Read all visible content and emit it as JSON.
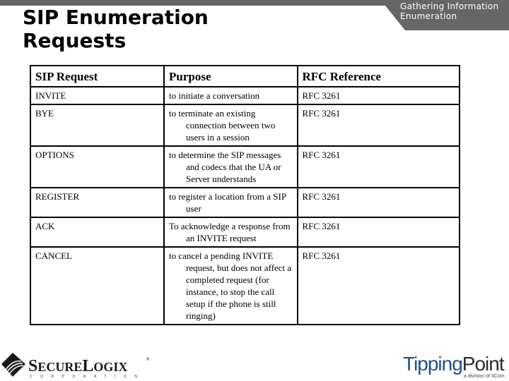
{
  "header": {
    "section_label_line1": "Gathering Information",
    "section_label_line2": "Enumeration",
    "bar_color": "#666666",
    "title_line1": "SIP Enumeration",
    "title_line2": "Requests"
  },
  "table": {
    "columns": [
      "SIP Request",
      "Purpose",
      "RFC Reference"
    ],
    "rows": [
      {
        "request": "INVITE",
        "purpose": "to initiate a conversation",
        "rfc": "RFC 3261"
      },
      {
        "request": "BYE",
        "purpose": "to terminate an existing connection between two users in a session",
        "rfc": "RFC 3261"
      },
      {
        "request": "OPTIONS",
        "purpose": "to determine the SIP messages and codecs that the UA or Server understands",
        "rfc": "RFC 3261"
      },
      {
        "request": "REGISTER",
        "purpose": "to register a location from a SIP user",
        "rfc": "RFC 3261"
      },
      {
        "request": "ACK",
        "purpose": "To acknowledge a response from an INVITE request",
        "rfc": "RFC 3261"
      },
      {
        "request": "CANCEL",
        "purpose": "to cancel a pending INVITE request, but does not affect a completed request (for instance, to stop the call setup if the phone is still ringing)",
        "rfc": "RFC 3261"
      }
    ]
  },
  "footer": {
    "left_logo": {
      "first": "S",
      "first_rest": "ECURE",
      "second": "L",
      "second_rest": "OGIX",
      "registered": "®",
      "subline": "CORPORATION"
    },
    "right_logo": {
      "tipping": "Tipping",
      "point": "Point",
      "subline": "a division of 3Com",
      "brand_color": "#1f4f8f"
    }
  }
}
